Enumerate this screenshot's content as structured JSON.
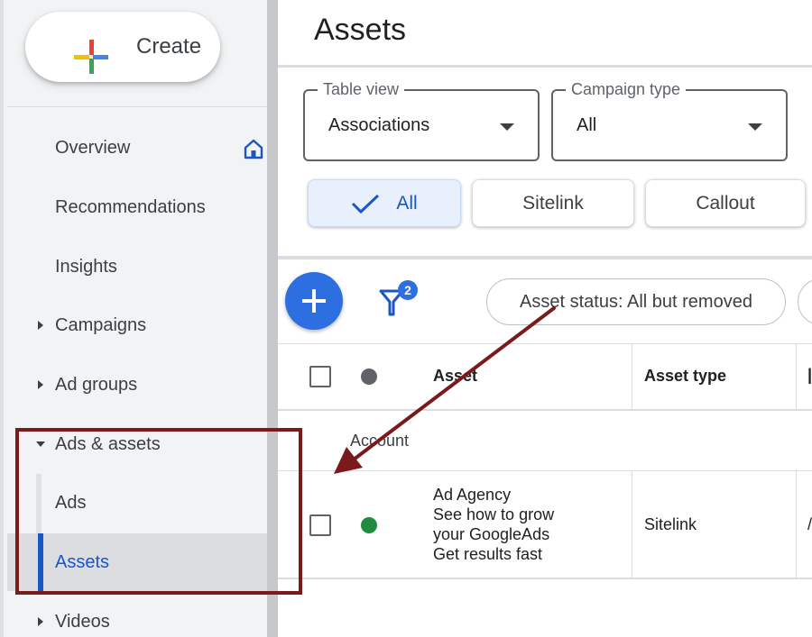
{
  "sidebar": {
    "create_label": "Create",
    "items": [
      {
        "label": "Overview"
      },
      {
        "label": "Recommendations"
      },
      {
        "label": "Insights"
      },
      {
        "label": "Campaigns"
      },
      {
        "label": "Ad groups"
      },
      {
        "label": "Ads & assets"
      },
      {
        "label": "Ads"
      },
      {
        "label": "Assets"
      },
      {
        "label": "Videos"
      }
    ]
  },
  "main": {
    "title": "Assets",
    "table_view": {
      "label": "Table view",
      "value": "Associations"
    },
    "campaign_type": {
      "label": "Campaign type",
      "value": "All"
    },
    "chips": [
      {
        "label": "All"
      },
      {
        "label": "Sitelink"
      },
      {
        "label": "Callout"
      }
    ],
    "filter_count": "2",
    "status_filter": "Asset status: All but removed",
    "table": {
      "columns": [
        "Asset",
        "Asset type"
      ],
      "group_label": "Account",
      "rows": [
        {
          "asset_lines": [
            "Ad Agency",
            "See how to grow",
            "your GoogleAds",
            "Get results fast"
          ],
          "asset_type": "Sitelink"
        }
      ]
    }
  },
  "colors": {
    "accent_blue": "#1a56c4",
    "fab_blue": "#2d6ee0",
    "status_green": "#1e8e3e",
    "annotation_red": "#7b1a1a"
  }
}
